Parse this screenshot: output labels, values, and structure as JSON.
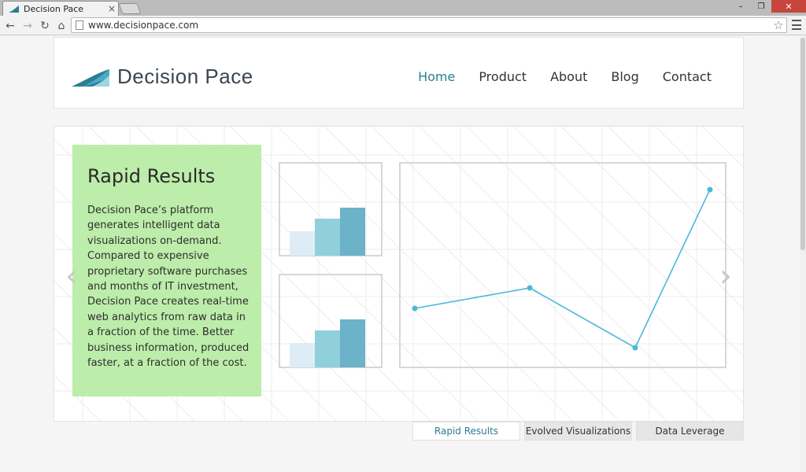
{
  "browser": {
    "tab_title": "Decision Pace",
    "tab_close": "×",
    "url": "www.decisionpace.com",
    "win_minimize": "–",
    "win_maximize": "❐",
    "win_close": "✕",
    "back_glyph": "←",
    "forward_glyph": "→",
    "reload_glyph": "↻",
    "home_glyph": "⌂",
    "star_glyph": "☆"
  },
  "site": {
    "logo_text": "Decision Pace",
    "nav": [
      {
        "label": "Home",
        "active": true
      },
      {
        "label": "Product",
        "active": false
      },
      {
        "label": "About",
        "active": false
      },
      {
        "label": "Blog",
        "active": false
      },
      {
        "label": "Contact",
        "active": false
      }
    ]
  },
  "hero": {
    "title": "Rapid Results",
    "body": "Decision Pace’s platform generates intelligent data visualizations on-demand. Compared to expensive proprietary software purchases and months of IT investment, Decision Pace creates real-time web analytics from raw data in a fraction of the time. Better business information, produced faster, at a fraction of the cost.",
    "prev_glyph": "‹",
    "next_glyph": "›"
  },
  "slider_tabs": [
    {
      "label": "Rapid Results",
      "active": true
    },
    {
      "label": "Evolved Visualizations",
      "active": false
    },
    {
      "label": "Data Leverage",
      "active": false
    }
  ],
  "colors": {
    "accent": "#2b7e93",
    "panel_green": "#bdedaa",
    "line_blue": "#4bb8db",
    "bar_light": "#deedf5",
    "bar_mid": "#8fd0dc",
    "bar_dark": "#6cb2c8"
  },
  "icons": {
    "tab_favicon": "decision-pace-logo-icon",
    "page": "page-icon",
    "star": "star-icon",
    "menu": "hamburger-menu-icon"
  }
}
